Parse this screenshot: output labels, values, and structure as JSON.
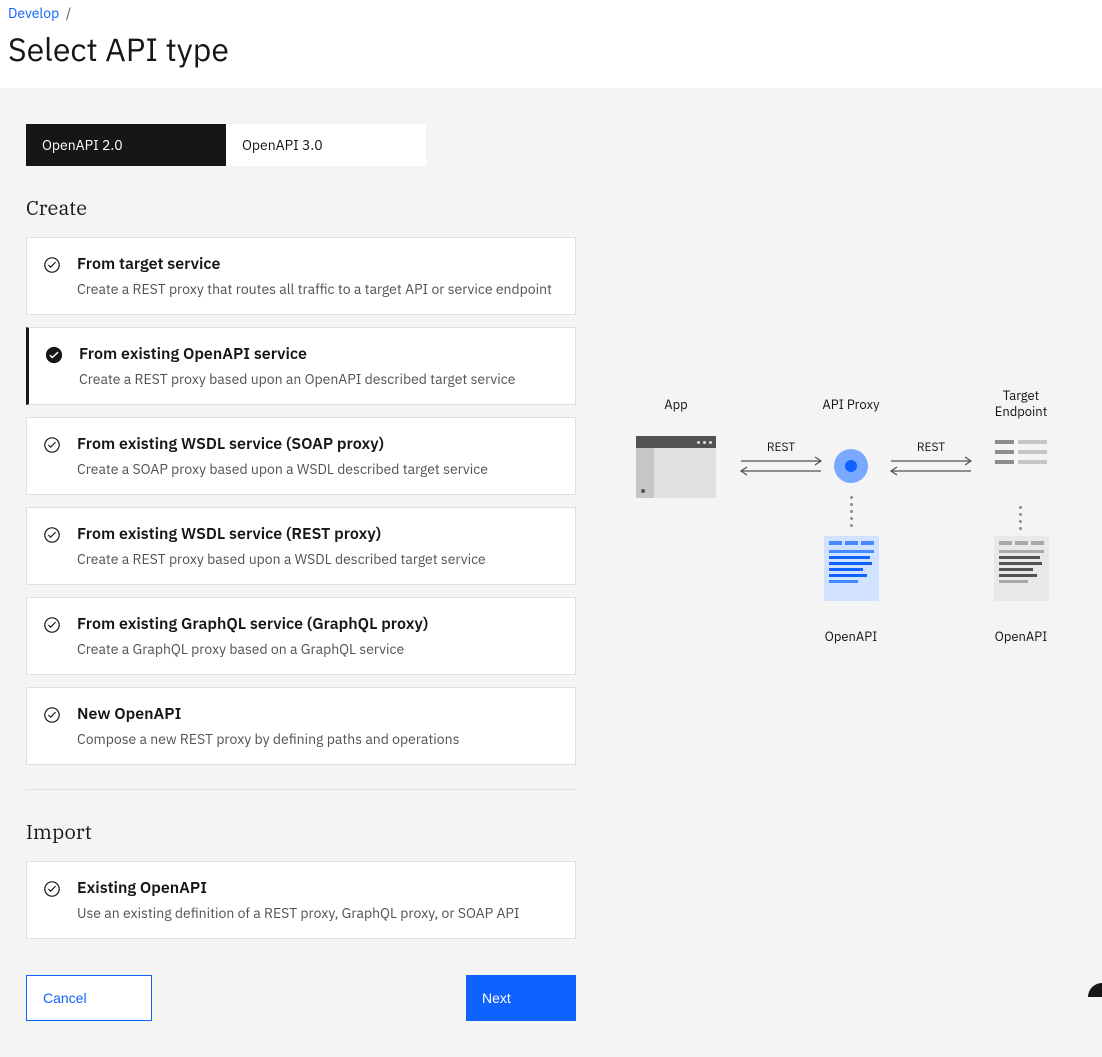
{
  "breadcrumb": {
    "parent": "Develop",
    "sep": "/"
  },
  "page": {
    "title": "Select API type"
  },
  "tabs": [
    {
      "label": "OpenAPI 2.0",
      "active": true
    },
    {
      "label": "OpenAPI 3.0",
      "active": false
    }
  ],
  "sections": {
    "create": {
      "heading": "Create",
      "cards": [
        {
          "title": "From target service",
          "desc": "Create a REST proxy that routes all traffic to a target API or service endpoint",
          "selected": false
        },
        {
          "title": "From existing OpenAPI service",
          "desc": "Create a REST proxy based upon an OpenAPI described target service",
          "selected": true
        },
        {
          "title": "From existing WSDL service (SOAP proxy)",
          "desc": "Create a SOAP proxy based upon a WSDL described target service",
          "selected": false
        },
        {
          "title": "From existing WSDL service (REST proxy)",
          "desc": "Create a REST proxy based upon a WSDL described target service",
          "selected": false
        },
        {
          "title": "From existing GraphQL service (GraphQL proxy)",
          "desc": "Create a GraphQL proxy based on a GraphQL service",
          "selected": false
        },
        {
          "title": "New OpenAPI",
          "desc": "Compose a new REST proxy by defining paths and operations",
          "selected": false
        }
      ]
    },
    "import": {
      "heading": "Import",
      "cards": [
        {
          "title": "Existing OpenAPI",
          "desc": "Use an existing definition of a REST proxy, GraphQL proxy, or SOAP API",
          "selected": false
        }
      ]
    }
  },
  "footer": {
    "cancel": "Cancel",
    "next": "Next"
  },
  "diagram": {
    "labels": {
      "app": "App",
      "proxy": "API Proxy",
      "endpoint": "Target Endpoint",
      "left_arrow": "REST",
      "right_arrow": "REST",
      "openapi_left": "OpenAPI",
      "openapi_right": "OpenAPI"
    }
  }
}
